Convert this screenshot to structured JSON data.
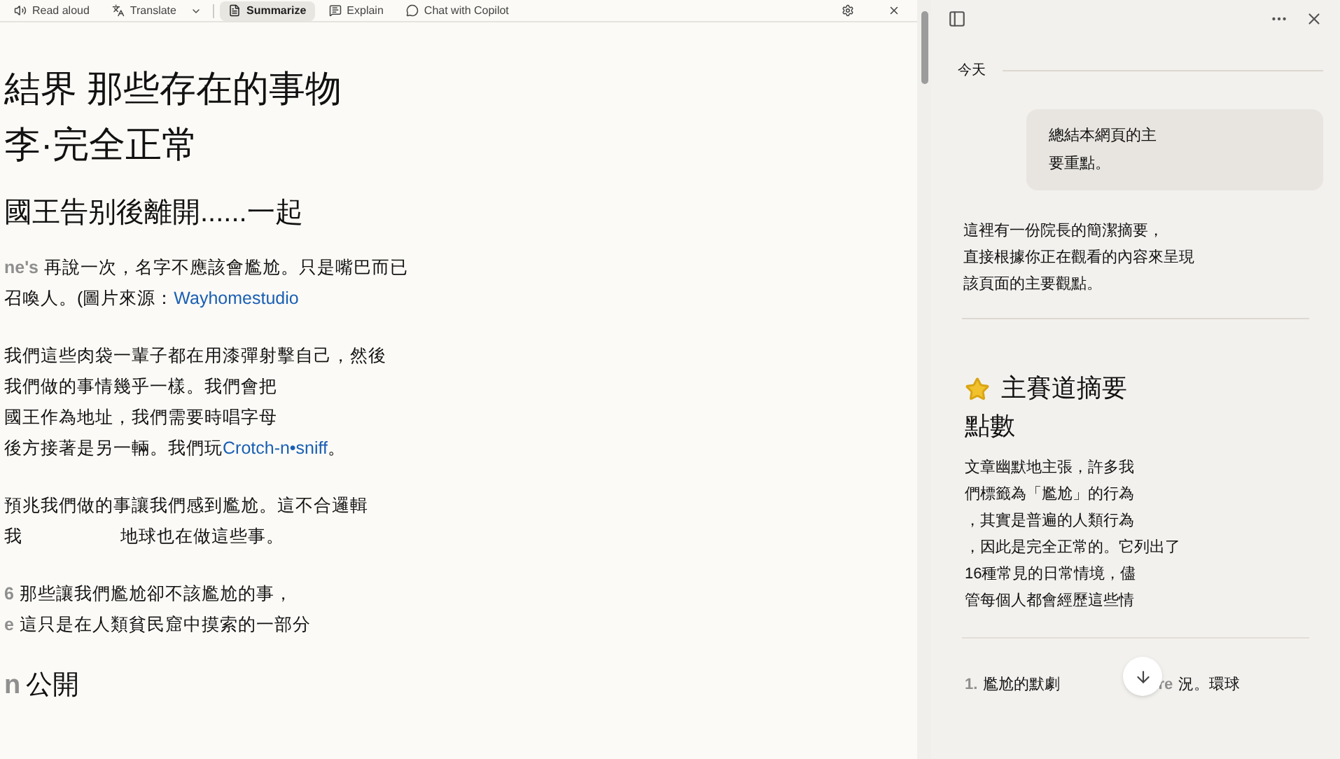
{
  "toolbar": {
    "items": [
      {
        "kind": "read",
        "label": "Read aloud",
        "selected": false
      },
      {
        "kind": "translate",
        "label": "Translate",
        "selected": false
      },
      {
        "kind": "summarize",
        "label": "Summarize",
        "selected": true
      },
      {
        "kind": "explain",
        "label": "Explain",
        "selected": false
      },
      {
        "kind": "chat",
        "label": "Chat with Copilot",
        "selected": false
      }
    ]
  },
  "article": {
    "title_lines": [
      "結界 那些存在的事物",
      "李·完全正常"
    ],
    "heading": "國王告别後離開......一起",
    "paragraphs": [
      [
        [
          {
            "kind": "faded",
            "text": "ne's"
          },
          {
            "kind": "text",
            "text": "再說一次，名字不應該會尷尬。只是嘴巴而已"
          }
        ],
        [
          {
            "kind": "text",
            "text": "召喚人。(圖片來源："
          },
          {
            "kind": "link",
            "text": "Wayhomestudio"
          }
        ]
      ],
      [
        [
          {
            "kind": "text",
            "text": "我們這些肉袋一輩子都在用漆彈射擊自己，然後"
          }
        ],
        [
          {
            "kind": "text",
            "text": "我們做的事情幾乎一樣。我們會把"
          }
        ],
        [
          {
            "kind": "text",
            "text": "國王作為地址，我們需要時唱字母"
          }
        ],
        [
          {
            "kind": "text",
            "text": "後方接著是另一輛。我們玩"
          },
          {
            "kind": "link",
            "text": "Crotch-n•sniff"
          },
          {
            "kind": "text",
            "text": "。"
          }
        ]
      ],
      [
        [
          {
            "kind": "text",
            "text": "預兆我們做的事讓我們感到尷尬。這不合邏輯"
          }
        ],
        [
          {
            "kind": "text",
            "text": "我"
          },
          {
            "kind": "gap"
          },
          {
            "kind": "text",
            "text": "地球也在做這些事。"
          }
        ]
      ],
      [
        [
          {
            "kind": "faded",
            "text": "6"
          },
          {
            "kind": "text",
            "text": "那些讓我們尷尬卻不該尷尬的事，"
          }
        ],
        [
          {
            "kind": "faded",
            "text": "e"
          },
          {
            "kind": "text",
            "text": "這只是在人類貧民窟中摸索的一部分"
          }
        ]
      ]
    ],
    "footer_heading": [
      {
        "kind": "faded",
        "text": "n"
      },
      {
        "kind": "text",
        "text": "公開"
      }
    ]
  },
  "panel": {
    "date_label": "今天",
    "user_message": [
      "總結本網頁的主",
      "要重點。"
    ],
    "reply": [
      "這裡有一份院長的簡潔摘要，",
      "直接根據你正在觀看的內容來呈現",
      "該頁面的主要觀點。"
    ],
    "section": {
      "title": "主賽道摘要",
      "subtitle": "點數",
      "body": [
        "文章幽默地主張，許多我",
        "們標籤為「尷尬」的行為",
        "，其實是普遍的人類行為",
        "，因此是完全正常的。它列出了",
        "16種常見的日常情境，儘",
        "管每個人都會經歷這些情"
      ]
    },
    "list_item": [
      {
        "kind": "faded",
        "text": "1."
      },
      {
        "kind": "text",
        "text": "尷尬的默劇"
      },
      {
        "kind": "gap"
      },
      {
        "kind": "faded",
        "text": "re"
      },
      {
        "kind": "text",
        "text": "況。環球"
      }
    ]
  }
}
